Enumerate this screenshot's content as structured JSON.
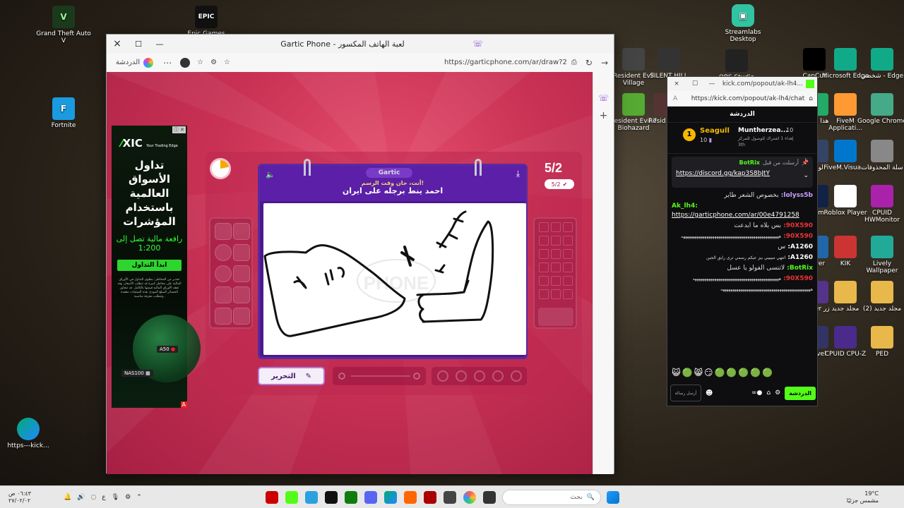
{
  "desktop": {
    "left_icons": [
      {
        "label": "Grand Theft Auto V"
      },
      {
        "label": "Fortnite"
      },
      {
        "label": "https---kick..."
      }
    ],
    "top_icons": [
      {
        "label": "Epic Games"
      },
      {
        "label": "Streamlabs Desktop"
      }
    ],
    "right_icons": [
      {
        "label": "Resident Evil Village"
      },
      {
        "label": "SILENT HILL"
      },
      {
        "label": "OBS Studio"
      },
      {
        "label": "CapCut"
      },
      {
        "label": "Microsoft Edge"
      },
      {
        "label": "شخصي - Edge"
      },
      {
        "label": "Resident Evil 7 Biohazard"
      },
      {
        "label": "Resid Tom"
      },
      {
        "label": "هذا الجها"
      },
      {
        "label": "FiveM Applicati..."
      },
      {
        "label": "Google Chrome"
      },
      {
        "label": "لوحة"
      },
      {
        "label": "FiveM.Visua..."
      },
      {
        "label": "سلة المحذوفات"
      },
      {
        "label": "eam"
      },
      {
        "label": "Roblox Player"
      },
      {
        "label": "CPUID HWMonitor"
      },
      {
        "label": "ewer"
      },
      {
        "label": "KIK"
      },
      {
        "label": "Lively Wallpaper"
      },
      {
        "label": "enter زر"
      },
      {
        "label": "مجلد جديد"
      },
      {
        "label": "(2) مجلد جديد"
      },
      {
        "label": "- Evel"
      },
      {
        "label": "CPUID CPU-Z"
      },
      {
        "label": "PED"
      }
    ]
  },
  "browser": {
    "tab_title": "Gartic Phone - لعبة الهاتف المكسور",
    "url": "https://garticphone.com/ar/draw?2",
    "chat_label": "الدردشة",
    "nav_icons": [
      "close-icon",
      "maximize-icon",
      "minimize-icon",
      "refresh-icon",
      "forward-icon"
    ]
  },
  "game": {
    "logo": "Gartic",
    "round": "5/2",
    "round_badge": "5/2",
    "prompt_intro": "أنت، حان وقت الرسم!",
    "prompt": "احمد ينط برجله على ايران",
    "edit_button": "التحرير"
  },
  "ad": {
    "brand": "XIC",
    "tagline": "Your Trading Edge",
    "headline": "تداول الأسواق العالمية باستخدام المؤشرات",
    "subline": "رافعة مالية تصل إلى",
    "leverage": "1:200",
    "cta": "ابدأ التداول",
    "disclaimer": "تحذير من المخاطر: ينطوي التداول في الأوراق المالية على مخاطر كبيرة قد تتطلب الأسعار، وقد تفقد الأوراق المالية قيمتها بالكامل. قد تتجاوز الخسائر المبلغ المودع. هذه المنتجات معقدة وتتطلب معرفة مناسبة.",
    "marker_a50": "A50",
    "marker_nas": "NAS100",
    "ad_choice": "A"
  },
  "kick": {
    "url_title": "kick.com/popout/ak-lh4...",
    "url": "https://kick.com/popout/ak-lh4/chat",
    "header": "الدردشة",
    "leaderboard": {
      "first_name": "Seagull",
      "first_count": "10",
      "second_name": "Muntherzea...",
      "second_count": "10",
      "second_sub": "إهداء 1 اشتراك للوصول للمركز",
      "second_rank": "3th",
      "rank_badge": "1"
    },
    "pinned": {
      "pinned_by": "أرسلت من قبل",
      "bot": "BotRix",
      "link": "https://discord.gg/kap3S8bJtY"
    },
    "messages": [
      {
        "user": "lolyss5b:",
        "text": "بخصوص الشعر طاير"
      },
      {
        "user": "Ak_lh4:",
        "text": "https://garticphone.com/ar/00e4791258"
      },
      {
        "user": "90X590:",
        "text": "بس بلاه ما ابدعت"
      },
      {
        "user": "90X590:",
        "text": "ههههههههههههههههههههههههههههههههههههههههههههههههههه"
      },
      {
        "user": "A1260:",
        "text": "س"
      },
      {
        "user": "A1260:",
        "text": "اتتهي مييييي بيز عيكم رسمي ترى رابق الجين"
      },
      {
        "user": "BotRix:",
        "text": "لاتنسى الفولو يا عسل"
      },
      {
        "user": "90X590:",
        "text": "ههههههههههههههههههههههههههههههههههههههههههههه"
      },
      {
        "user": "",
        "text": "ههههههههههههههههههههههههههههههههههههههههههههههه"
      }
    ],
    "send_label": "الدردشة",
    "input_label": "أرسل رسالة"
  },
  "taskbar": {
    "search_placeholder": "بحث",
    "weather_temp": "19°C",
    "weather_desc": "مشمس جزئيًا",
    "time": "٠٦:٤٣ ص",
    "date": "٢٧/٠٢/٠٢",
    "lang": "ع"
  },
  "colors": {
    "game_bg": "#c93154",
    "card_purple": "#5b1fa8",
    "kick_green": "#53fc18"
  }
}
